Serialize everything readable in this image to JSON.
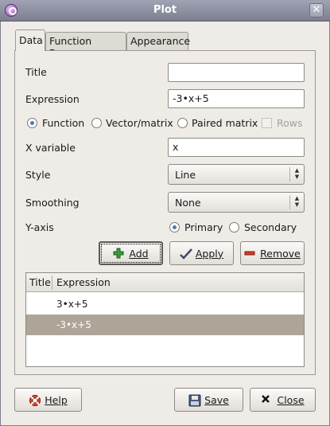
{
  "window": {
    "title": "Plot"
  },
  "tabs": [
    {
      "label": "Data"
    },
    {
      "label": "Function Range"
    },
    {
      "label": "Appearance"
    }
  ],
  "form": {
    "title_label": "Title",
    "title_value": "",
    "expression_label": "Expression",
    "expression_value": "-3•x+5",
    "type_options": [
      "Function",
      "Vector/matrix",
      "Paired matrix"
    ],
    "type_selected": "Function",
    "rows_label": "Rows",
    "xvar_label": "X variable",
    "xvar_value": "x",
    "style_label": "Style",
    "style_value": "Line",
    "smoothing_label": "Smoothing",
    "smoothing_value": "None",
    "yaxis_label": "Y-axis",
    "yaxis_options": [
      "Primary",
      "Secondary"
    ],
    "yaxis_selected": "Primary"
  },
  "actions": {
    "add": "Add",
    "apply": "Apply",
    "remove": "Remove"
  },
  "list": {
    "headers": [
      "Title",
      "Expression"
    ],
    "rows": [
      {
        "title": "",
        "expression": "3•x+5"
      },
      {
        "title": "",
        "expression": "-3•x+5"
      }
    ],
    "selected_index": 1
  },
  "footer": {
    "help": "Help",
    "save": "Save",
    "close": "Close"
  },
  "colors": {
    "titlebar": "#8f92a3",
    "selection": "#aea497",
    "accent": "#4a78c0"
  }
}
